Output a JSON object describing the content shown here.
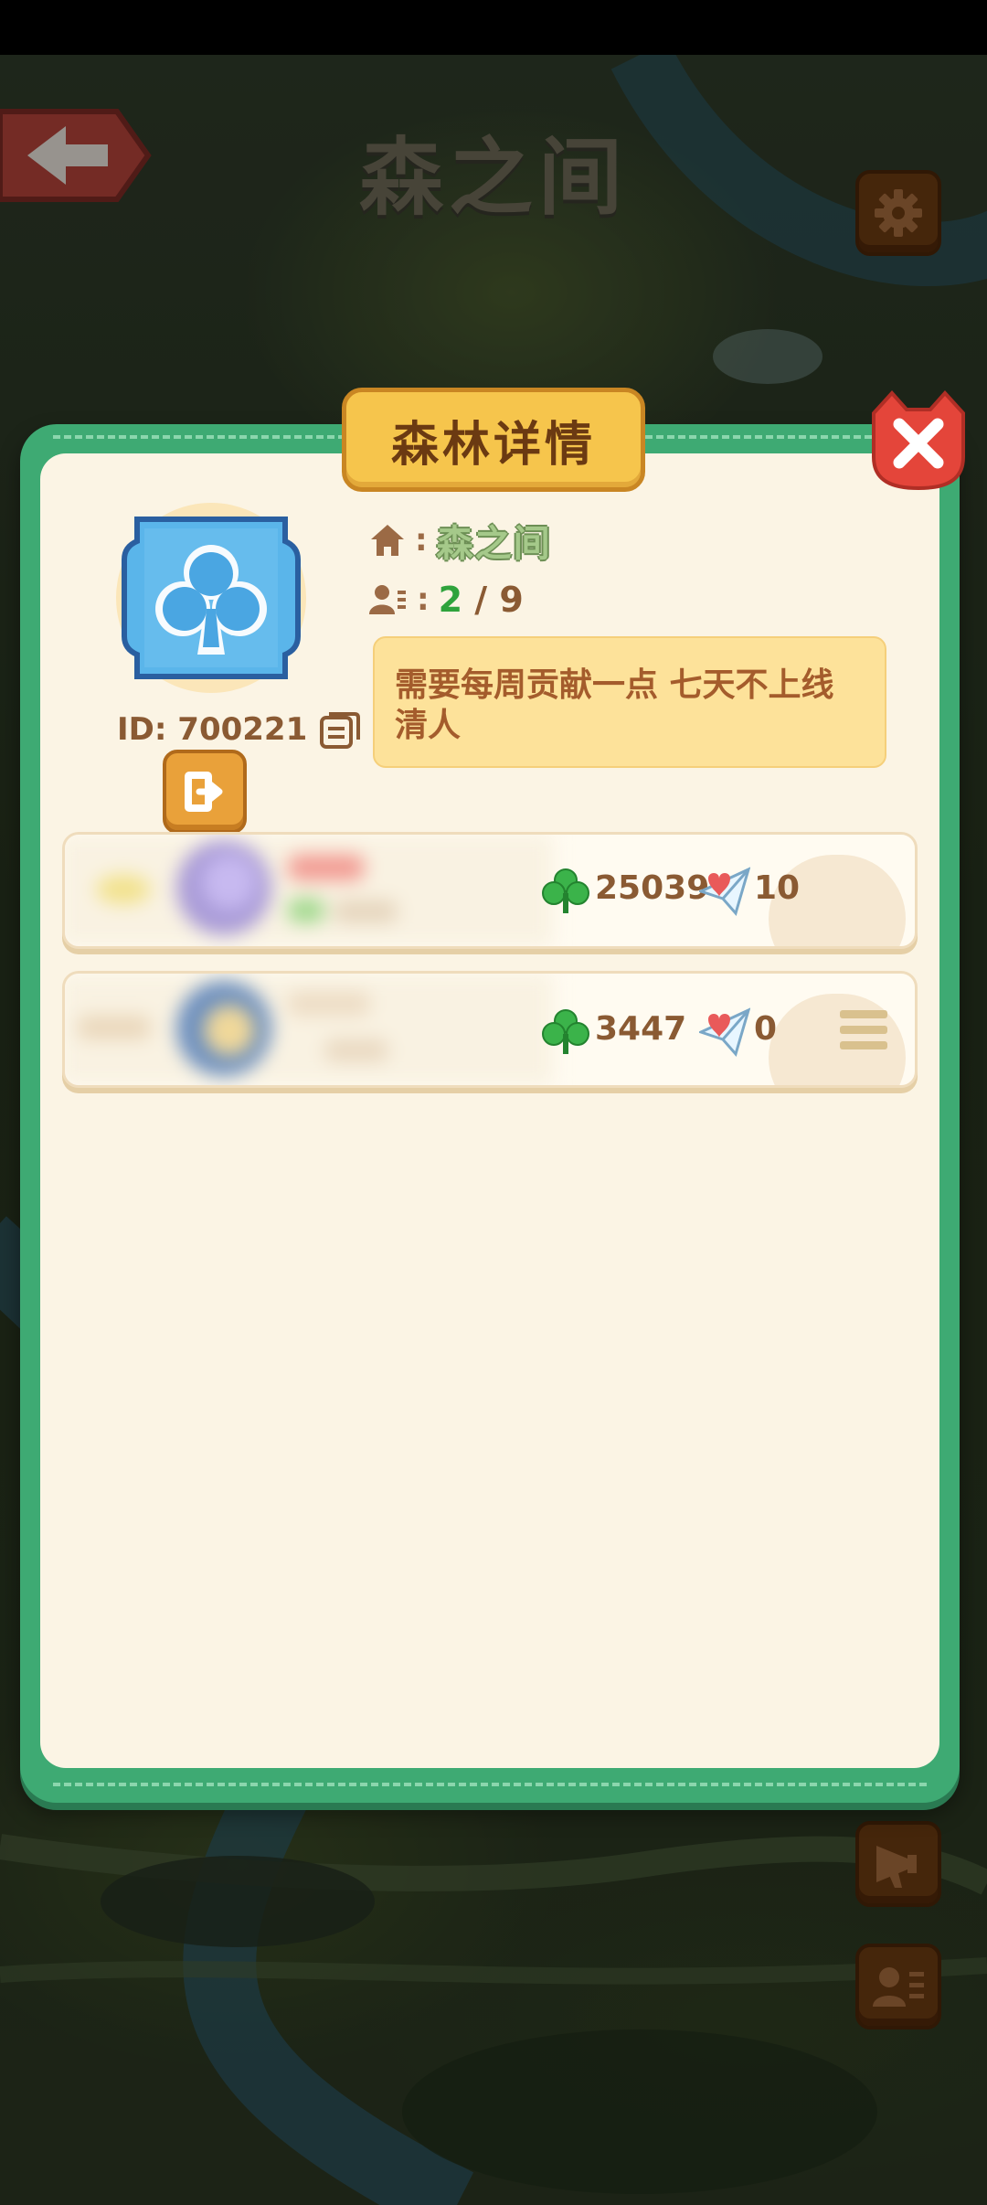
{
  "map": {
    "title": "森之间",
    "back_icon": "arrow-left-icon",
    "settings_icon": "gear-icon",
    "side_buttons": [
      "megaphone-icon",
      "profile-card-icon"
    ]
  },
  "panel": {
    "title": "森林详情",
    "close_icon": "close-icon"
  },
  "forest": {
    "emblem_icon": "club-icon",
    "id_text": "ID: 700221",
    "name": "森之间",
    "colon": ":",
    "members_current": "2",
    "members_sep": " / ",
    "members_max": "9",
    "notice": "需要每周贡献一点  七天不上线清人"
  },
  "members": [
    {
      "name": "",
      "clovers": "25039",
      "gifts": "10",
      "menu": false
    },
    {
      "name": "",
      "clovers": "3447",
      "gifts": "0",
      "menu": true
    }
  ],
  "colors": {
    "panel_green": "#3eaa73",
    "panel_bg": "#fbf4e4",
    "title_yellow": "#f6c54c",
    "close_red": "#e4453a",
    "clover_green": "#3bb34a",
    "text_brown": "#8a5a33",
    "count_green": "#2fa33c"
  }
}
